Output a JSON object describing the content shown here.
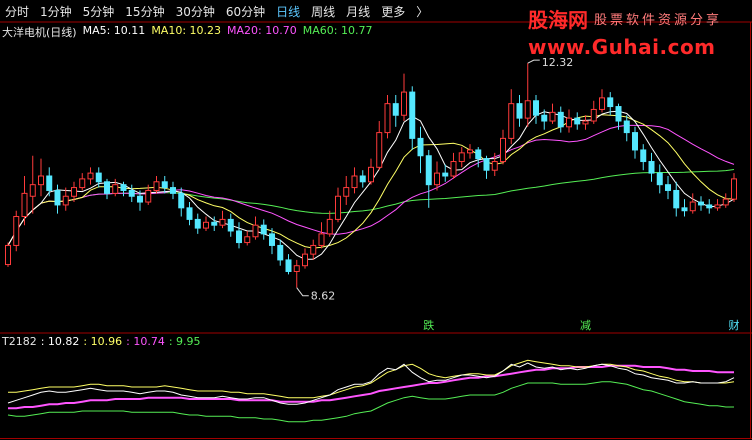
{
  "tabs": [
    "分时",
    "1分钟",
    "5分钟",
    "15分钟",
    "30分钟",
    "60分钟",
    "日线",
    "周线",
    "月线",
    "更多"
  ],
  "active_tab": "日线",
  "more_arrow": "〉",
  "watermark": {
    "brand": "股海网",
    "slogan": "股票软件资源分享",
    "url": "www.Guhai.com"
  },
  "legend": {
    "stock": "大洋电机(日线)",
    "ma5": "MA5: 10.11",
    "ma10": "MA10: 10.23",
    "ma20": "MA20: 10.70",
    "ma60": "MA60: 10.77"
  },
  "sub_legend": {
    "name": "T2182",
    "v1": ": 10.82",
    "v2": ": 10.96",
    "v3": ": 10.74",
    "v4": ": 9.95"
  },
  "colors": {
    "up": "#ff3b3b",
    "down": "#55e8ff",
    "ma5": "#ffffff",
    "ma10": "#ffff66",
    "ma20": "#ff55ff",
    "ma60": "#55ee55",
    "sub1": "#ffffff",
    "sub2": "#ffff66",
    "sub3": "#ff55ff",
    "sub4": "#55ee55",
    "panel": "#a00000"
  },
  "chart_data": {
    "type": "candlestick",
    "ylim": [
      8.2,
      12.9
    ],
    "high_label": "12.32",
    "low_label": "8.62",
    "candles": [
      [
        9.02,
        9.35,
        8.98,
        9.4
      ],
      [
        9.35,
        9.85,
        9.25,
        9.95
      ],
      [
        9.85,
        10.25,
        9.7,
        10.55
      ],
      [
        10.2,
        10.4,
        9.9,
        10.9
      ],
      [
        10.4,
        10.55,
        10.2,
        10.85
      ],
      [
        10.55,
        10.3,
        10.2,
        10.7
      ],
      [
        10.3,
        10.05,
        9.9,
        10.4
      ],
      [
        10.05,
        10.2,
        9.95,
        10.35
      ],
      [
        10.2,
        10.35,
        10.1,
        10.45
      ],
      [
        10.35,
        10.5,
        10.3,
        10.6
      ],
      [
        10.5,
        10.6,
        10.4,
        10.7
      ],
      [
        10.6,
        10.45,
        10.35,
        10.7
      ],
      [
        10.45,
        10.25,
        10.15,
        10.5
      ],
      [
        10.25,
        10.4,
        10.2,
        10.5
      ],
      [
        10.4,
        10.3,
        10.2,
        10.45
      ],
      [
        10.3,
        10.2,
        10.1,
        10.4
      ],
      [
        10.2,
        10.1,
        9.95,
        10.3
      ],
      [
        10.1,
        10.3,
        10.05,
        10.4
      ],
      [
        10.3,
        10.45,
        10.25,
        10.55
      ],
      [
        10.45,
        10.35,
        10.25,
        10.55
      ],
      [
        10.35,
        10.25,
        10.15,
        10.45
      ],
      [
        10.25,
        10.0,
        9.85,
        10.35
      ],
      [
        10.0,
        9.8,
        9.7,
        10.1
      ],
      [
        9.8,
        9.65,
        9.55,
        9.9
      ],
      [
        9.65,
        9.75,
        9.6,
        9.85
      ],
      [
        9.75,
        9.7,
        9.6,
        9.85
      ],
      [
        9.7,
        9.8,
        9.65,
        9.95
      ],
      [
        9.8,
        9.6,
        9.5,
        9.9
      ],
      [
        9.6,
        9.4,
        9.3,
        9.75
      ],
      [
        9.4,
        9.5,
        9.35,
        9.6
      ],
      [
        9.5,
        9.7,
        9.45,
        9.85
      ],
      [
        9.7,
        9.55,
        9.45,
        9.8
      ],
      [
        9.55,
        9.35,
        9.2,
        9.65
      ],
      [
        9.35,
        9.1,
        9.0,
        9.45
      ],
      [
        9.1,
        8.9,
        8.85,
        9.2
      ],
      [
        8.9,
        9.0,
        8.62,
        9.1
      ],
      [
        9.0,
        9.2,
        8.95,
        9.3
      ],
      [
        9.2,
        9.35,
        9.1,
        9.45
      ],
      [
        9.35,
        9.55,
        9.3,
        9.75
      ],
      [
        9.55,
        9.8,
        9.5,
        9.95
      ],
      [
        9.8,
        10.2,
        9.75,
        10.35
      ],
      [
        10.2,
        10.35,
        10.05,
        10.55
      ],
      [
        10.35,
        10.55,
        10.25,
        10.7
      ],
      [
        10.55,
        10.45,
        10.35,
        10.65
      ],
      [
        10.45,
        10.7,
        10.4,
        10.85
      ],
      [
        10.7,
        11.3,
        10.65,
        11.5
      ],
      [
        11.3,
        11.8,
        11.2,
        11.95
      ],
      [
        11.8,
        11.6,
        11.4,
        11.95
      ],
      [
        11.6,
        12.0,
        11.5,
        12.32
      ],
      [
        12.0,
        11.2,
        11.0,
        12.1
      ],
      [
        11.2,
        10.9,
        10.6,
        11.4
      ],
      [
        10.9,
        10.4,
        10.0,
        11.0
      ],
      [
        10.4,
        10.6,
        10.3,
        10.8
      ],
      [
        10.6,
        10.55,
        10.45,
        10.75
      ],
      [
        10.55,
        10.8,
        10.5,
        10.95
      ],
      [
        10.8,
        10.95,
        10.7,
        11.05
      ],
      [
        10.95,
        11.0,
        10.85,
        11.1
      ],
      [
        11.0,
        10.85,
        10.7,
        11.05
      ],
      [
        10.85,
        10.65,
        10.5,
        10.9
      ],
      [
        10.65,
        10.8,
        10.55,
        10.95
      ],
      [
        10.8,
        11.2,
        10.75,
        11.35
      ],
      [
        11.2,
        11.8,
        11.1,
        12.05
      ],
      [
        11.8,
        11.55,
        11.4,
        11.95
      ],
      [
        11.55,
        11.85,
        11.4,
        12.5
      ],
      [
        11.85,
        11.6,
        11.45,
        11.95
      ],
      [
        11.6,
        11.5,
        11.35,
        11.7
      ],
      [
        11.5,
        11.65,
        11.45,
        11.8
      ],
      [
        11.65,
        11.4,
        11.3,
        11.75
      ],
      [
        11.4,
        11.55,
        11.3,
        11.7
      ],
      [
        11.55,
        11.45,
        11.35,
        11.65
      ],
      [
        11.45,
        11.5,
        11.35,
        11.6
      ],
      [
        11.5,
        11.7,
        11.45,
        11.85
      ],
      [
        11.7,
        11.9,
        11.65,
        12.05
      ],
      [
        11.9,
        11.75,
        11.6,
        12.0
      ],
      [
        11.75,
        11.5,
        11.35,
        11.8
      ],
      [
        11.5,
        11.3,
        11.15,
        11.6
      ],
      [
        11.3,
        11.0,
        10.85,
        11.4
      ],
      [
        11.0,
        10.8,
        10.65,
        11.1
      ],
      [
        10.8,
        10.6,
        10.45,
        10.95
      ],
      [
        10.6,
        10.4,
        10.25,
        10.75
      ],
      [
        10.4,
        10.3,
        10.15,
        10.55
      ],
      [
        10.3,
        10.0,
        9.85,
        10.45
      ],
      [
        10.0,
        9.95,
        9.85,
        10.15
      ],
      [
        9.95,
        10.1,
        9.9,
        10.25
      ],
      [
        10.1,
        10.05,
        9.95,
        10.2
      ],
      [
        10.05,
        10.0,
        9.9,
        10.15
      ],
      [
        10.0,
        10.05,
        9.95,
        10.15
      ],
      [
        10.05,
        10.15,
        10.0,
        10.25
      ],
      [
        10.15,
        10.5,
        10.1,
        10.6
      ]
    ],
    "markers": [
      {
        "label": "跌",
        "index": 51,
        "color": "#55ee55"
      },
      {
        "label": "减",
        "index": 70,
        "color": "#55ee55"
      },
      {
        "label": "财",
        "index": 88,
        "color": "#55e8ff"
      }
    ],
    "sub": {
      "ylim": [
        6.0,
        12.6
      ],
      "series": [
        {
          "key": "T2182",
          "values": [
            8.4,
            8.6,
            8.8,
            9.0,
            9.2,
            9.3,
            9.2,
            9.2,
            9.3,
            9.4,
            9.5,
            9.4,
            9.3,
            9.3,
            9.3,
            9.2,
            9.1,
            9.2,
            9.3,
            9.3,
            9.2,
            9.0,
            8.9,
            8.8,
            8.8,
            8.8,
            8.9,
            8.8,
            8.7,
            8.7,
            8.8,
            8.8,
            8.6,
            8.4,
            8.3,
            8.3,
            8.4,
            8.6,
            8.8,
            9.0,
            9.4,
            9.6,
            9.8,
            9.8,
            10.0,
            10.6,
            11.0,
            10.9,
            11.3,
            10.7,
            10.3,
            10.0,
            10.1,
            10.1,
            10.3,
            10.5,
            10.5,
            10.4,
            10.3,
            10.4,
            10.8,
            11.3,
            11.1,
            11.4,
            11.1,
            11.0,
            11.1,
            10.9,
            11.0,
            10.9,
            11.0,
            11.2,
            11.3,
            11.2,
            11.0,
            10.9,
            10.6,
            10.5,
            10.3,
            10.2,
            10.1,
            9.9,
            9.9,
            10.0,
            9.9,
            9.9,
            9.9,
            10.0,
            10.3
          ]
        },
        {
          "key": "v2",
          "values": [
            9.2,
            9.2,
            9.3,
            9.4,
            9.5,
            9.6,
            9.6,
            9.6,
            9.6,
            9.7,
            9.8,
            9.8,
            9.7,
            9.7,
            9.7,
            9.6,
            9.6,
            9.6,
            9.6,
            9.7,
            9.6,
            9.5,
            9.4,
            9.3,
            9.3,
            9.3,
            9.3,
            9.2,
            9.2,
            9.1,
            9.1,
            9.1,
            9.0,
            8.9,
            8.8,
            8.8,
            8.8,
            8.8,
            8.9,
            9.0,
            9.2,
            9.4,
            9.6,
            9.7,
            9.9,
            10.3,
            10.7,
            10.9,
            11.2,
            11.3,
            11.0,
            10.6,
            10.4,
            10.3,
            10.4,
            10.5,
            10.6,
            10.6,
            10.5,
            10.5,
            10.8,
            11.2,
            11.4,
            11.6,
            11.5,
            11.4,
            11.3,
            11.2,
            11.2,
            11.1,
            11.1,
            11.2,
            11.3,
            11.3,
            11.2,
            11.1,
            10.9,
            10.8,
            10.6,
            10.4,
            10.3,
            10.1,
            10.0,
            10.0,
            9.9,
            9.9,
            9.9,
            9.9,
            10.0
          ]
        },
        {
          "key": "v3",
          "values": [
            8.0,
            8.0,
            8.1,
            8.1,
            8.2,
            8.3,
            8.3,
            8.4,
            8.4,
            8.5,
            8.6,
            8.6,
            8.6,
            8.7,
            8.7,
            8.7,
            8.7,
            8.8,
            8.8,
            8.8,
            8.8,
            8.8,
            8.7,
            8.7,
            8.7,
            8.7,
            8.7,
            8.7,
            8.6,
            8.6,
            8.6,
            8.6,
            8.6,
            8.5,
            8.5,
            8.5,
            8.5,
            8.5,
            8.6,
            8.6,
            8.7,
            8.8,
            8.9,
            9.0,
            9.1,
            9.3,
            9.4,
            9.5,
            9.6,
            9.7,
            9.8,
            9.9,
            9.9,
            10.0,
            10.1,
            10.2,
            10.3,
            10.3,
            10.4,
            10.4,
            10.5,
            10.6,
            10.7,
            10.8,
            10.9,
            10.9,
            11.0,
            11.0,
            11.0,
            11.1,
            11.1,
            11.1,
            11.1,
            11.2,
            11.2,
            11.2,
            11.2,
            11.1,
            11.1,
            11.1,
            11.0,
            10.9,
            10.9,
            10.8,
            10.8,
            10.8,
            10.7,
            10.7,
            10.7
          ]
        },
        {
          "key": "v4",
          "values": [
            7.5,
            7.4,
            7.4,
            7.5,
            7.6,
            7.7,
            7.7,
            7.7,
            7.7,
            7.8,
            7.8,
            7.8,
            7.8,
            7.8,
            7.8,
            7.7,
            7.7,
            7.7,
            7.7,
            7.7,
            7.7,
            7.6,
            7.5,
            7.5,
            7.4,
            7.4,
            7.4,
            7.4,
            7.3,
            7.3,
            7.3,
            7.2,
            7.2,
            7.1,
            7.0,
            7.0,
            7.0,
            7.1,
            7.1,
            7.2,
            7.3,
            7.4,
            7.6,
            7.7,
            7.8,
            8.1,
            8.4,
            8.6,
            8.8,
            8.9,
            8.8,
            8.7,
            8.7,
            8.7,
            8.8,
            8.9,
            9.0,
            9.0,
            9.0,
            9.0,
            9.2,
            9.5,
            9.7,
            9.9,
            9.9,
            9.9,
            9.9,
            9.8,
            9.8,
            9.8,
            9.8,
            9.9,
            10.0,
            10.0,
            9.9,
            9.8,
            9.6,
            9.4,
            9.3,
            9.1,
            8.9,
            8.7,
            8.5,
            8.4,
            8.3,
            8.2,
            8.2,
            8.1,
            8.1
          ]
        }
      ]
    }
  }
}
